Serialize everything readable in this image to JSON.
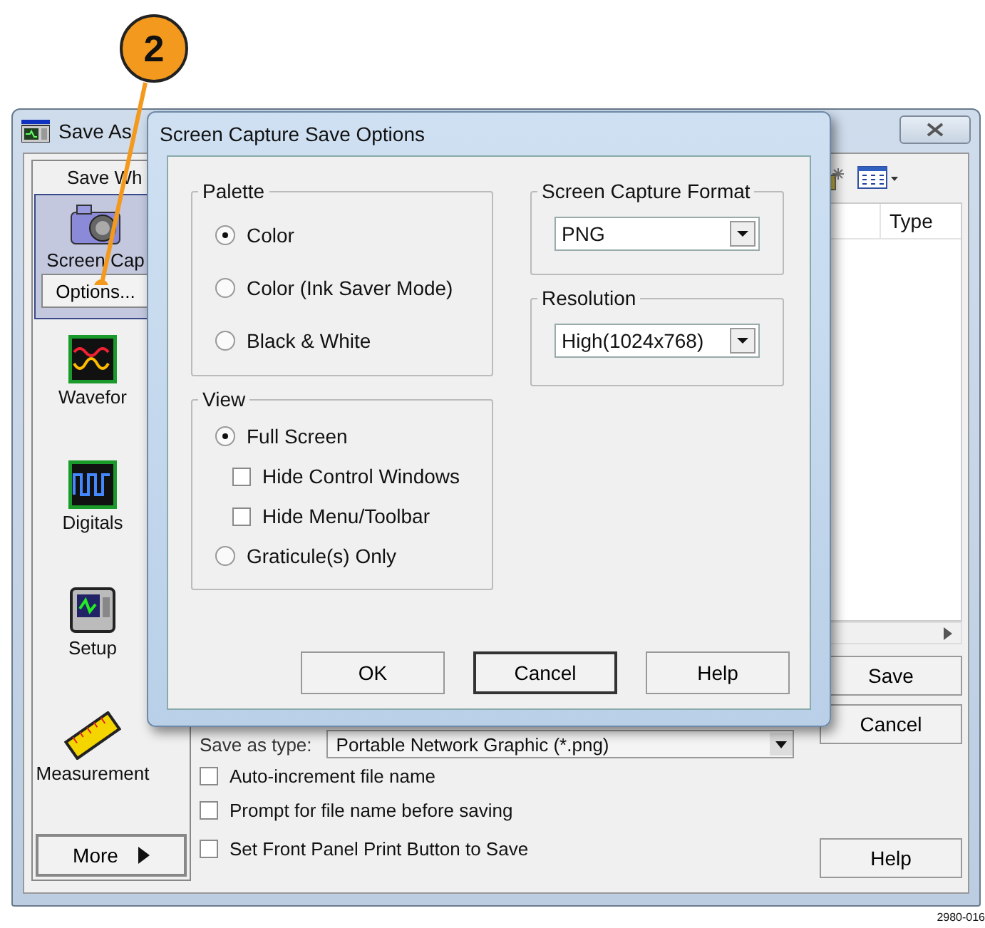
{
  "callout": {
    "number": "2"
  },
  "save_window": {
    "title": "Save As",
    "sidebar_heading": "Save Wh",
    "sidebar_items": [
      {
        "kind": "camera",
        "label": "Screen Cap",
        "selected": true,
        "button": "Options..."
      },
      {
        "kind": "waveform",
        "label": "Wavefor",
        "selected": false
      },
      {
        "kind": "digital",
        "label": "Digitals",
        "selected": false
      },
      {
        "kind": "setup",
        "label": "Setup",
        "selected": false
      },
      {
        "kind": "ruler",
        "label": "Measurement",
        "selected": false
      }
    ],
    "more_button": "More",
    "file_list": {
      "columns": [
        "Type"
      ]
    },
    "save_as_type": {
      "label": "Save as type:",
      "value": "Portable Network Graphic (*.png)"
    },
    "options": [
      {
        "label": "Auto-increment file name",
        "checked": false
      },
      {
        "label": "Prompt for file name before saving",
        "checked": false
      },
      {
        "label": "Set Front Panel Print Button to Save",
        "checked": false
      }
    ],
    "buttons": [
      "Save",
      "Cancel",
      "Help"
    ]
  },
  "dialog": {
    "title": "Screen Capture Save Options",
    "palette": {
      "label": "Palette",
      "options": [
        {
          "label": "Color",
          "selected": true
        },
        {
          "label": "Color (Ink Saver Mode)",
          "selected": false
        },
        {
          "label": "Black & White",
          "selected": false
        }
      ]
    },
    "view": {
      "label": "View",
      "options": [
        {
          "kind": "radio",
          "label": "Full Screen",
          "selected": true
        },
        {
          "kind": "checkbox",
          "label": "Hide Control Windows",
          "checked": false
        },
        {
          "kind": "checkbox",
          "label": "Hide Menu/Toolbar",
          "checked": false
        },
        {
          "kind": "radio",
          "label": "Graticule(s) Only",
          "selected": false
        }
      ]
    },
    "format": {
      "label": "Screen Capture Format",
      "value": "PNG"
    },
    "resolution": {
      "label": "Resolution",
      "value": "High(1024x768)"
    },
    "buttons": [
      {
        "label": "OK",
        "default": false
      },
      {
        "label": "Cancel",
        "default": true
      },
      {
        "label": "Help",
        "default": false
      }
    ]
  },
  "figure_id": "2980-016"
}
